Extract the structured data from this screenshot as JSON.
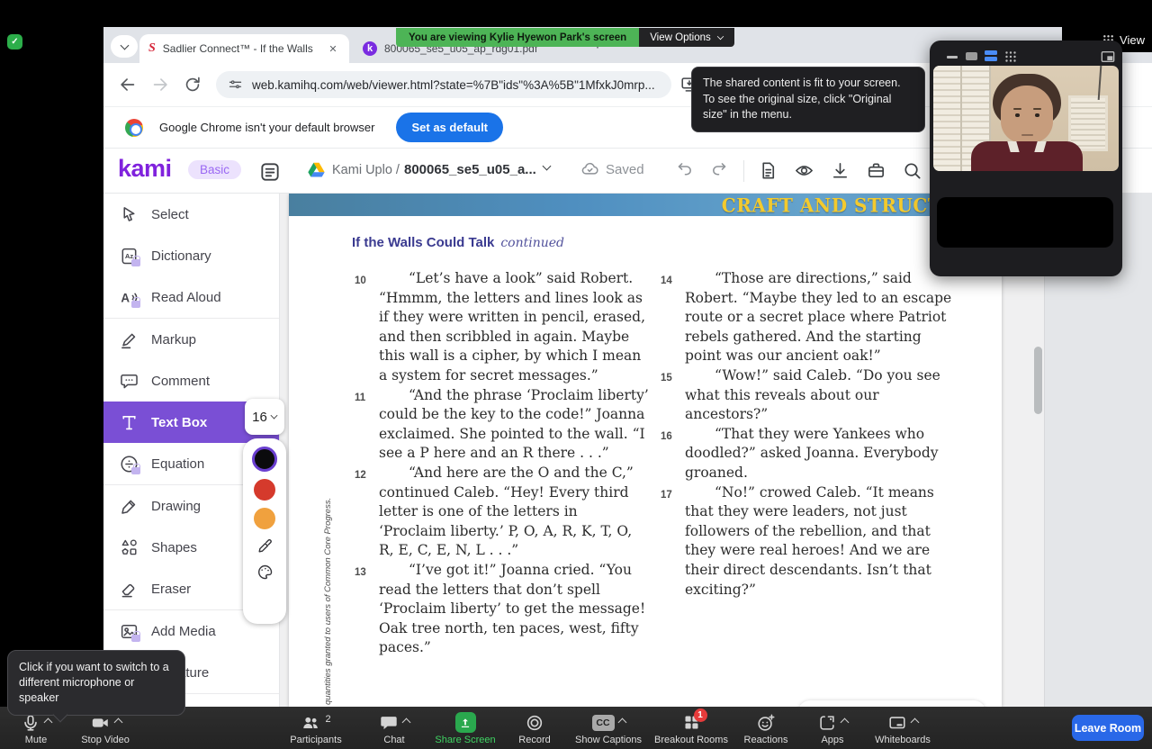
{
  "meeting": {
    "screen_banner": "You are viewing Kylie Hyewon Park's screen",
    "view_options_label": "View Options",
    "view_label": "View",
    "fit_tooltip": "The shared content is fit to your screen. To see the original size, click \"Original size\" in the menu.",
    "mic_tooltip": "Click if you want to switch to a different microphone or speaker",
    "toolbar": {
      "mute": "Mute",
      "stop_video": "Stop Video",
      "participants": "Participants",
      "participants_count": "2",
      "chat": "Chat",
      "share_screen": "Share Screen",
      "record": "Record",
      "show_captions": "Show Captions",
      "cc_icon_label": "CC",
      "breakout_rooms": "Breakout Rooms",
      "breakout_badge": "1",
      "reactions": "Reactions",
      "apps": "Apps",
      "whiteboards": "Whiteboards",
      "leave": "Leave Room"
    }
  },
  "browser": {
    "tab_1": "Sadlier Connect™ - If the Walls",
    "tab_2": "800065_se5_u05_ap_rdg01.pdf",
    "url": "web.kamihq.com/web/viewer.html?state=%7B\"ids\"%3A%5B\"1MfxkJ0mrp...",
    "default_browser_notice": "Google Chrome isn't your default browser",
    "set_default_button": "Set as default"
  },
  "kami": {
    "logo": "kami",
    "plan_badge": "Basic",
    "breadcrumb": "Kami Uplo /",
    "file_name": "800065_se5_u05_a...",
    "saved_status": "Saved",
    "font_size": "16",
    "tools": {
      "select": "Select",
      "dictionary": "Dictionary",
      "read_aloud": "Read Aloud",
      "markup": "Markup",
      "comment": "Comment",
      "text_box": "Text Box",
      "equation": "Equation",
      "drawing": "Drawing",
      "shapes": "Shapes",
      "eraser": "Eraser",
      "add_media": "Add Media",
      "signature": "Signature"
    }
  },
  "document": {
    "section_header": "CRAFT AND STRUCTURE",
    "title": "If the Walls Could Talk",
    "title_suffix": "continued",
    "margin_note": "quantities granted to users of Common Core Progress.",
    "left_paragraphs": [
      {
        "num": "10",
        "text": "“Let’s have a look” said Robert. “Hmmm, the letters and lines look as if they were written in pencil, erased, and then scribbled in again. Maybe this wall is a cipher, by which I mean a system for secret messages.”"
      },
      {
        "num": "11",
        "text": "“And the phrase ‘Proclaim liberty’ could be the key to the code!” Joanna exclaimed. She pointed to the wall. “I see a P here and an R there . . .”"
      },
      {
        "num": "12",
        "text": "“And here are the O and the C,” continued Caleb. “Hey! Every third letter is one of the letters in ‘Proclaim liberty.’ P, O, A, R, K, T, O, R, E, C, E, N, L . . .”"
      },
      {
        "num": "13",
        "text": "“I’ve got it!” Joanna cried. “You read the letters that don’t spell ‘Proclaim liberty’ to get the message! Oak tree north, ten paces, west, fifty paces.”"
      }
    ],
    "right_paragraphs": [
      {
        "num": "14",
        "text": "“Those are directions,” said Robert. “Maybe they led to an escape route or a secret place where Patriot rebels gathered. And the starting point was our ancient oak!”"
      },
      {
        "num": "15",
        "text": "“Wow!” said Caleb. “Do you see what this reveals about our ancestors?”"
      },
      {
        "num": "16",
        "text": "“That they were Yankees who doodled?” asked Joanna. Everybody groaned."
      },
      {
        "num": "17",
        "text": "“No!” crowed Caleb. “It means that they were leaders, not just followers of the rebellion, and that they were real heroes! And we are their direct descendants. Isn’t that exciting?”"
      }
    ]
  },
  "colors": {
    "kami_purple": "#8022dd",
    "tool_active_purple": "#7a4fd5",
    "banner_green": "#4db456",
    "share_active_green": "#3fd463",
    "leave_blue": "#2968e8",
    "chrome_blue": "#1a73e8",
    "pdf_header_blue": "#4f8fc0",
    "pdf_header_yellow": "#f3ca2e"
  }
}
